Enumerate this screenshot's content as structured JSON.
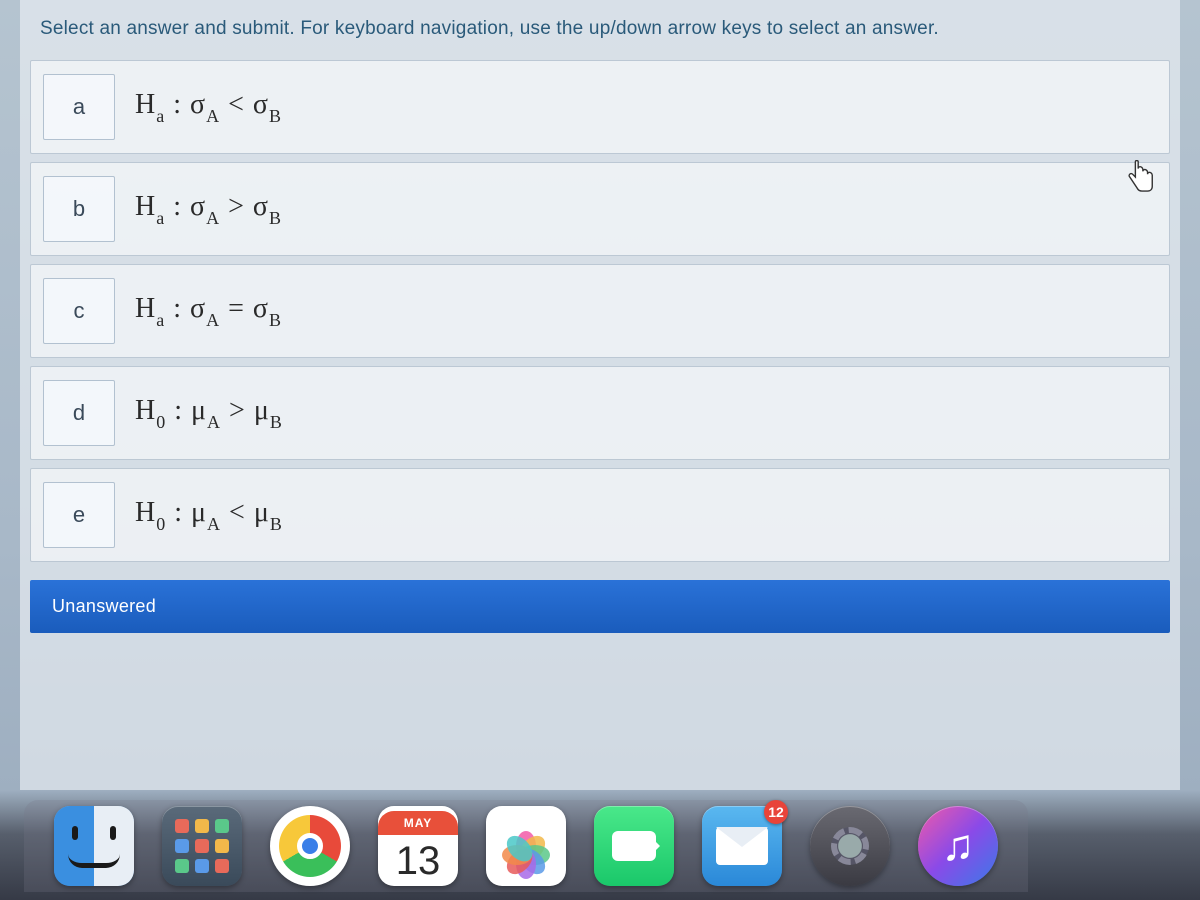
{
  "instruction": "Select an answer and submit. For keyboard navigation, use the up/down arrow keys to select an answer.",
  "options": [
    {
      "letter": "a",
      "hypothesis": "H",
      "hyp_sub": "a",
      "lhs": "σ",
      "lhs_sub": "A",
      "op": "<",
      "rhs": "σ",
      "rhs_sub": "B"
    },
    {
      "letter": "b",
      "hypothesis": "H",
      "hyp_sub": "a",
      "lhs": "σ",
      "lhs_sub": "A",
      "op": ">",
      "rhs": "σ",
      "rhs_sub": "B"
    },
    {
      "letter": "c",
      "hypothesis": "H",
      "hyp_sub": "a",
      "lhs": "σ",
      "lhs_sub": "A",
      "op": "=",
      "rhs": "σ",
      "rhs_sub": "B"
    },
    {
      "letter": "d",
      "hypothesis": "H",
      "hyp_sub": "0",
      "lhs": "μ",
      "lhs_sub": "A",
      "op": ">",
      "rhs": "μ",
      "rhs_sub": "B"
    },
    {
      "letter": "e",
      "hypothesis": "H",
      "hyp_sub": "0",
      "lhs": "μ",
      "lhs_sub": "A",
      "op": "<",
      "rhs": "μ",
      "rhs_sub": "B"
    }
  ],
  "status": "Unanswered",
  "dock": {
    "calendar_month": "MAY",
    "calendar_day": "13",
    "mail_badge": "12"
  },
  "launchpad_colors": [
    "#e86a5a",
    "#f2b84a",
    "#5ac88a",
    "#5a9ae8",
    "#e86a5a",
    "#f2b84a",
    "#5ac88a",
    "#5a9ae8",
    "#e86a5a"
  ],
  "petal_colors": [
    "#f25aa8",
    "#f2b84a",
    "#5ac88a",
    "#5a9ae8",
    "#a86ae8",
    "#e85a5a",
    "#f28a4a",
    "#4ac8c8"
  ]
}
